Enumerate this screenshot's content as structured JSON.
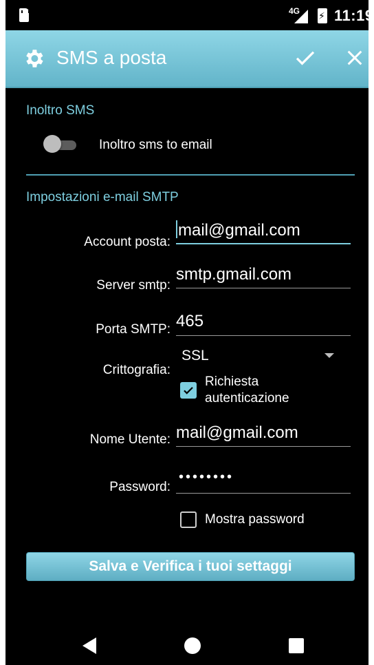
{
  "status_bar": {
    "network": "4G",
    "time": "11:19"
  },
  "app_bar": {
    "title": "SMS a posta",
    "icons": [
      "gear-icon",
      "check-icon",
      "close-icon"
    ]
  },
  "sms_forward": {
    "section_title": "Inoltro SMS",
    "toggle_label": "Inoltro sms to email",
    "toggle_on": false
  },
  "smtp": {
    "section_title": "Impostazioni e-mail SMTP",
    "account_label": "Account posta:",
    "account_value": "mail@gmail.com",
    "server_label": "Server smtp:",
    "server_value": "smtp.gmail.com",
    "port_label": "Porta SMTP:",
    "port_value": "465",
    "crypto_label": "Crittografia:",
    "crypto_value": "SSL",
    "auth_label_line1": "Richiesta",
    "auth_label_line2": "autenticazione",
    "auth_checked": true,
    "username_label": "Nome Utente:",
    "username_value": "mail@gmail.com",
    "password_label": "Password:",
    "password_mask": "••••••••",
    "show_password_label": "Mostra password",
    "show_password_checked": false
  },
  "save_button": "Salva e Verifica i tuoi settaggi",
  "colors": {
    "accent": "#7ecfe0",
    "app_bar": "#6fc0d4",
    "background": "#000000"
  }
}
